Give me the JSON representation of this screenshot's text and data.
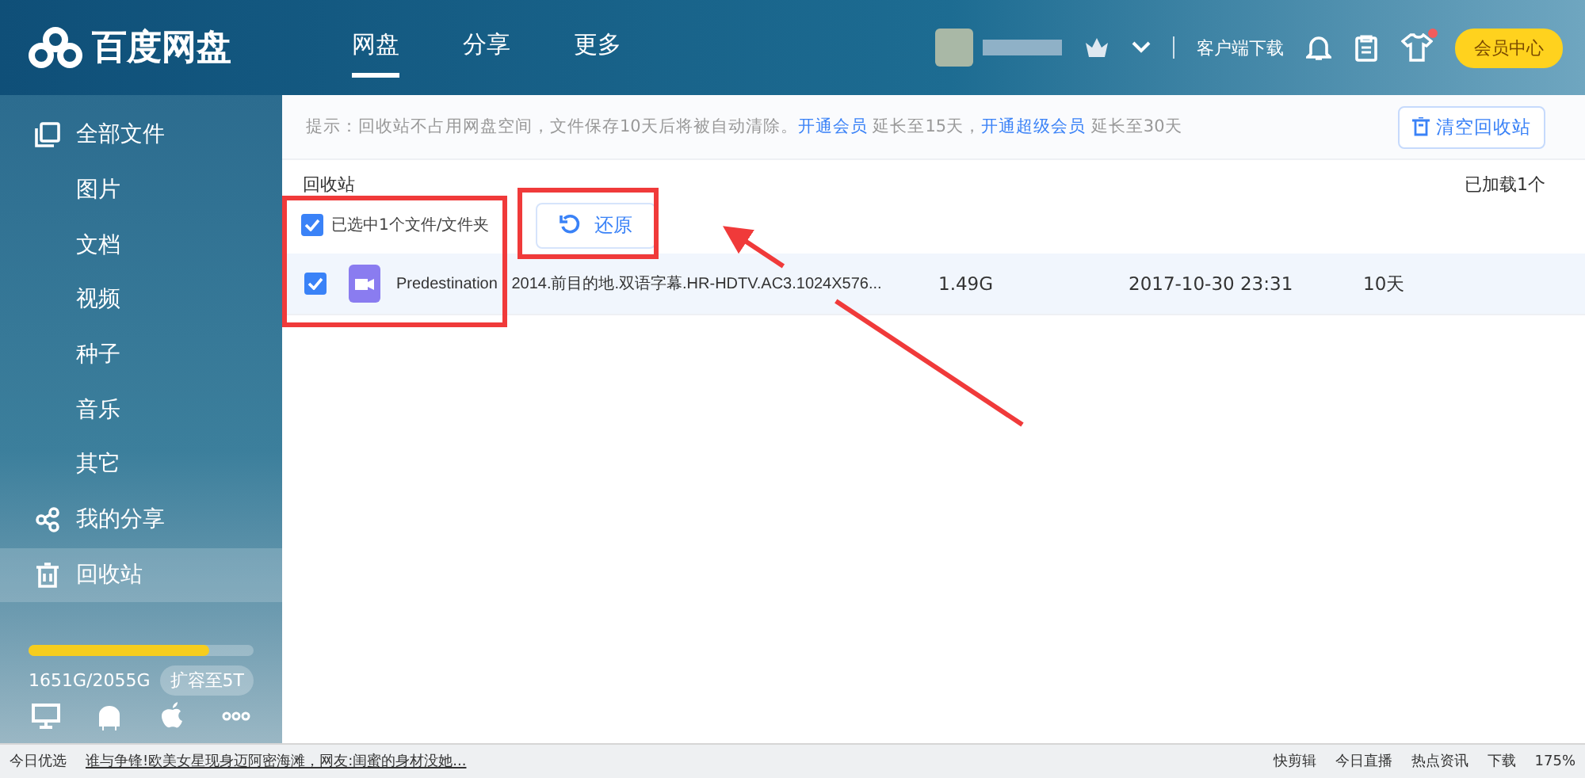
{
  "header": {
    "logo_text": "百度网盘",
    "nav": [
      {
        "label": "网盘",
        "selected": true
      },
      {
        "label": "分享",
        "selected": false
      },
      {
        "label": "更多",
        "selected": false
      }
    ],
    "client_download": "客户端下载",
    "has_notification": true,
    "vip_button": "会员中心"
  },
  "sidebar": {
    "items": [
      {
        "label": "全部文件",
        "kind": "files",
        "selected": false,
        "children": [
          {
            "label": "图片"
          },
          {
            "label": "文档"
          },
          {
            "label": "视频"
          },
          {
            "label": "种子"
          },
          {
            "label": "音乐"
          },
          {
            "label": "其它"
          }
        ]
      },
      {
        "label": "我的分享",
        "kind": "share",
        "selected": false
      },
      {
        "label": "回收站",
        "kind": "trash",
        "selected": true
      }
    ],
    "storage": {
      "level": 0.8,
      "usage": "1651G/2055G",
      "expand_button": "扩容至5T"
    }
  },
  "notice": {
    "parts": [
      {
        "kind": "text",
        "text": "提示：回收站不占用网盘空间，文件保存10天后将被自动清除。"
      },
      {
        "kind": "link",
        "text": "开通会员"
      },
      {
        "kind": "text",
        "text": " 延长至15天，"
      },
      {
        "kind": "link",
        "text": "开通超级会员"
      },
      {
        "kind": "text",
        "text": " 延长至30天"
      }
    ],
    "clear_button": "清空回收站"
  },
  "breadcrumb": "回收站",
  "loaded_count": "已加载1个",
  "selection": {
    "checked": true,
    "label": "已选中1个文件/文件夹",
    "restore_button": "还原"
  },
  "rows": [
    {
      "checked": true,
      "name": "Predestination 2014.前目的地.双语字幕.HR-HDTV.AC3.1024X576...",
      "size": "1.49G",
      "date": "2017-10-30 23:31",
      "days": "10天"
    }
  ],
  "status_bar": {
    "left": "今日优选",
    "headline": "谁与争锋!欧美女星现身迈阿密海滩，网友:闺蜜的身材没她...",
    "items": [
      "快剪辑",
      "今日直播",
      "热点资讯"
    ],
    "download": "下载",
    "zoom": "175%"
  }
}
